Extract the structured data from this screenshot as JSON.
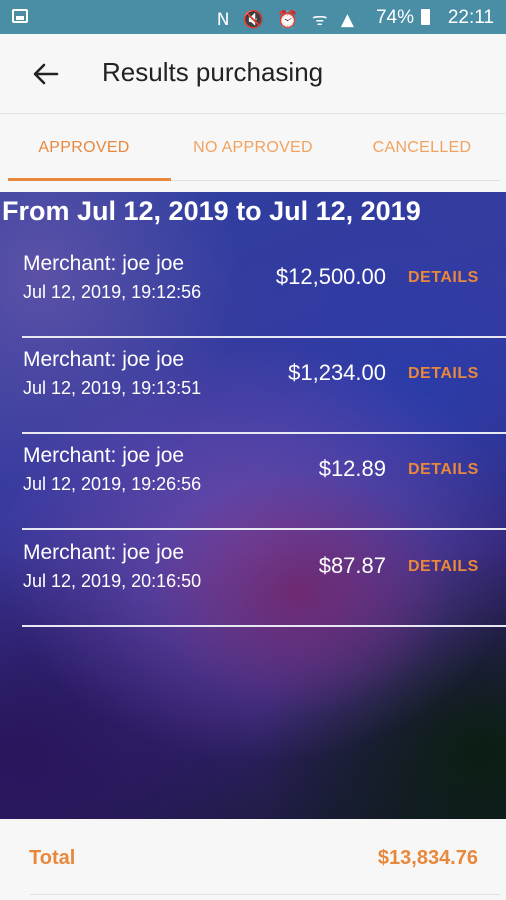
{
  "status_bar": {
    "icons": "N 🔇 ⏰ ᯤ ▲",
    "battery": "74%",
    "time": "22:11"
  },
  "header": {
    "title": "Results purchasing"
  },
  "tabs": [
    {
      "label": "APPROVED",
      "active": true
    },
    {
      "label": "NO APPROVED",
      "active": false
    },
    {
      "label": "CANCELLED",
      "active": false
    }
  ],
  "date_range": "From Jul 12, 2019 to Jul 12, 2019",
  "transactions": [
    {
      "merchant": "Merchant: joe joe",
      "date": "Jul 12, 2019, 19:12:56",
      "amount": "$12,500.00",
      "action": "DETAILS"
    },
    {
      "merchant": "Merchant: joe joe",
      "date": "Jul 12, 2019, 19:13:51",
      "amount": "$1,234.00",
      "action": "DETAILS"
    },
    {
      "merchant": "Merchant: joe joe",
      "date": "Jul 12, 2019, 19:26:56",
      "amount": "$12.89",
      "action": "DETAILS"
    },
    {
      "merchant": "Merchant: joe joe",
      "date": "Jul 12, 2019, 20:16:50",
      "amount": "$87.87",
      "action": "DETAILS"
    }
  ],
  "total": {
    "label": "Total",
    "value": "$13,834.76"
  },
  "colors": {
    "accent": "#e8883c",
    "status_bar": "#4a8ea6"
  }
}
